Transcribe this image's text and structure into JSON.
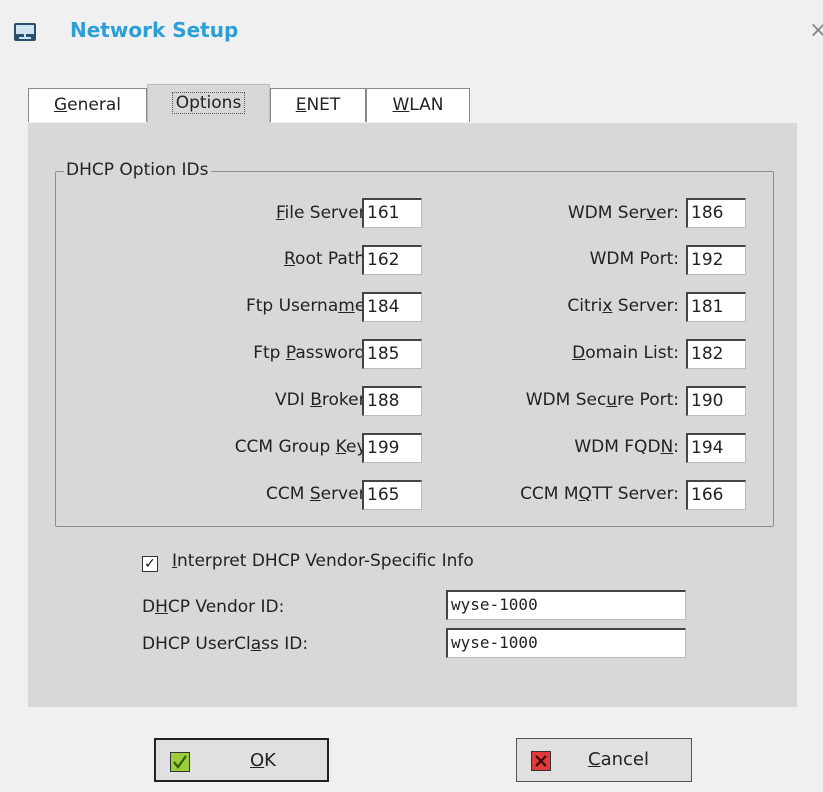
{
  "window": {
    "title": "Network Setup",
    "close_glyph": "×",
    "app_icon": "network-monitor-icon"
  },
  "tabs": [
    {
      "label": "General",
      "mnemonic": "G",
      "active": false
    },
    {
      "label": "Options",
      "mnemonic": "",
      "active": true
    },
    {
      "label": "ENET",
      "mnemonic": "E",
      "active": false
    },
    {
      "label": "WLAN",
      "mnemonic": "W",
      "active": false
    }
  ],
  "dhcp_group": {
    "title": "DHCP Option IDs",
    "left": [
      {
        "label": "File Server:",
        "value": "161"
      },
      {
        "label": "Root Path:",
        "value": "162"
      },
      {
        "label": "Ftp Username:",
        "value": "184"
      },
      {
        "label": "Ftp Password:",
        "value": "185"
      },
      {
        "label": "VDI Broker:",
        "value": "188"
      },
      {
        "label": "CCM Group Key:",
        "value": "199"
      },
      {
        "label": "CCM Server:",
        "value": "165"
      }
    ],
    "right": [
      {
        "label": "WDM Server:",
        "value": "186"
      },
      {
        "label": "WDM Port:",
        "value": "192"
      },
      {
        "label": "Citrix Server:",
        "value": "181"
      },
      {
        "label": "Domain List:",
        "value": "182"
      },
      {
        "label": "WDM Secure Port:",
        "value": "190"
      },
      {
        "label": "WDM FQDN:",
        "value": "194"
      },
      {
        "label": "CCM MQTT Server:",
        "value": "166"
      }
    ]
  },
  "vendor_info": {
    "checkbox_label": "Interpret DHCP Vendor-Specific Info",
    "checked": true,
    "vendor_id_label": "DHCP Vendor ID:",
    "vendor_id_value": "wyse-1000",
    "userclass_label": "DHCP UserClass ID:",
    "userclass_value": "wyse-1000"
  },
  "buttons": {
    "ok": "OK",
    "cancel": "Cancel"
  },
  "colors": {
    "title": "#2b9fd6",
    "ok_icon": "#9ccc3a",
    "cancel_icon": "#e03a3a",
    "panel": "#d8d8d8"
  }
}
